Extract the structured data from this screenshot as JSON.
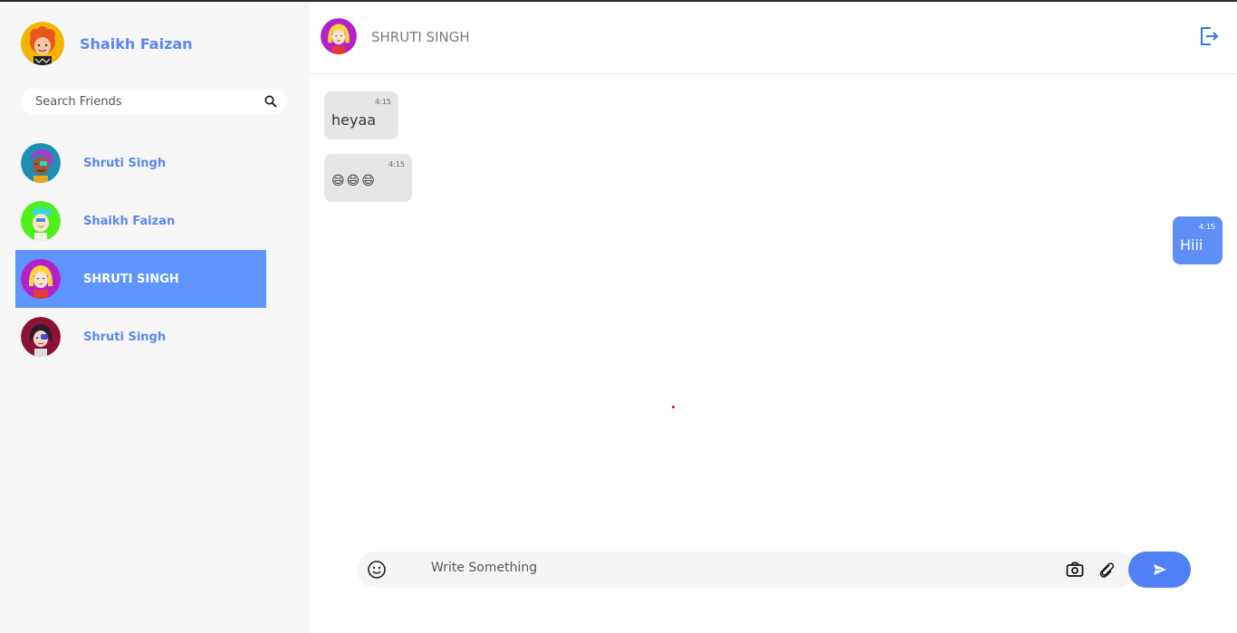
{
  "user": {
    "name": "Shaikh Faizan"
  },
  "search": {
    "placeholder": "Search Friends"
  },
  "contacts": [
    {
      "name": "Shruti Singh"
    },
    {
      "name": "Shaikh Faizan"
    },
    {
      "name": "SHRUTI SINGH"
    },
    {
      "name": "Shruti Singh"
    }
  ],
  "chat": {
    "title": "SHRUTI SINGH",
    "messages": [
      {
        "direction": "incoming",
        "time": "4:15",
        "text": "heyaa"
      },
      {
        "direction": "incoming",
        "time": "4:15",
        "text": "😄😄😄"
      },
      {
        "direction": "outgoing",
        "time": "4:15",
        "text": "Hiii"
      }
    ]
  },
  "composer": {
    "placeholder": "Write Something"
  },
  "icons": {
    "search": "search-icon",
    "logout": "logout-icon",
    "emoji": "smiley-icon",
    "camera": "camera-icon",
    "attach": "paperclip-icon",
    "send": "send-icon"
  },
  "colors": {
    "accent": "#5b87f2",
    "active_contact": "#5f95ff",
    "outgoing_bubble": "#5f8ef7",
    "incoming_bubble": "#e6e6e6",
    "send_button": "#4f80f5"
  }
}
